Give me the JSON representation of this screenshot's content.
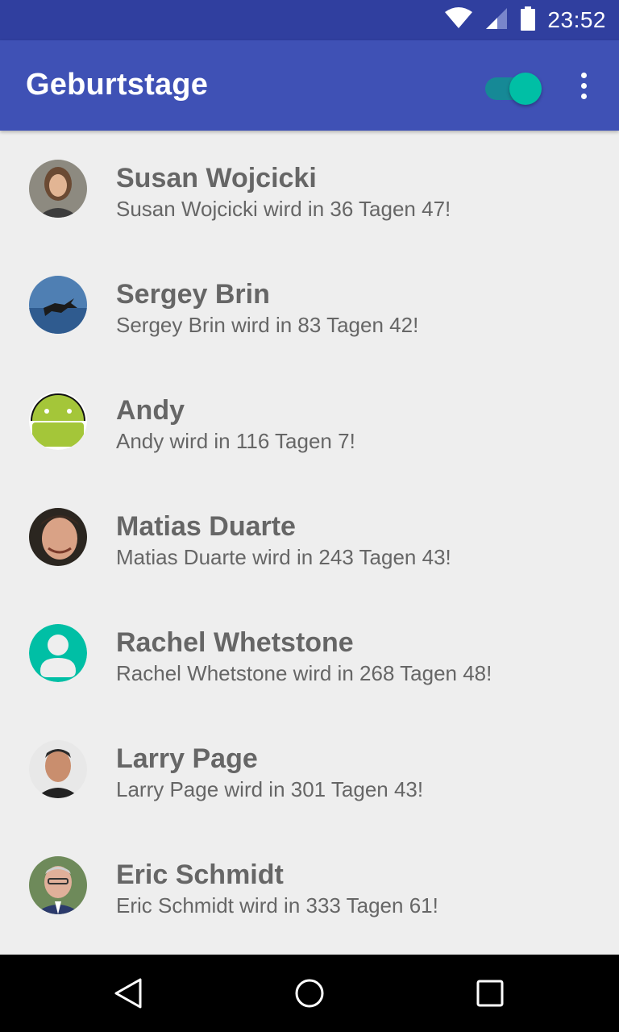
{
  "status_bar": {
    "time": "23:52",
    "icons": [
      "wifi-icon",
      "cell-signal-icon",
      "battery-icon"
    ]
  },
  "app_bar": {
    "title": "Geburtstage",
    "switch_on": true,
    "accent_color": "#00bfa5",
    "primary_color": "#3f51b5",
    "primary_dark_color": "#303f9f"
  },
  "contacts": [
    {
      "name": "Susan Wojcicki",
      "text": "Susan Wojcicki wird in 36 Tagen 47!",
      "avatar": "photo"
    },
    {
      "name": "Sergey Brin",
      "text": "Sergey Brin wird in 83 Tagen 42!",
      "avatar": "photo"
    },
    {
      "name": "Andy",
      "text": "Andy wird in 116 Tagen 7!",
      "avatar": "android-icon"
    },
    {
      "name": "Matias Duarte",
      "text": "Matias Duarte wird in 243 Tagen 43!",
      "avatar": "photo"
    },
    {
      "name": "Rachel Whetstone",
      "text": "Rachel Whetstone wird in 268 Tagen 48!",
      "avatar": "default-person-icon"
    },
    {
      "name": "Larry Page",
      "text": "Larry Page wird in 301 Tagen 43!",
      "avatar": "photo"
    },
    {
      "name": "Eric Schmidt",
      "text": "Eric Schmidt wird in 333 Tagen 61!",
      "avatar": "photo"
    }
  ],
  "nav_bar": {
    "icons": [
      "back-icon",
      "home-icon",
      "recents-icon"
    ]
  }
}
